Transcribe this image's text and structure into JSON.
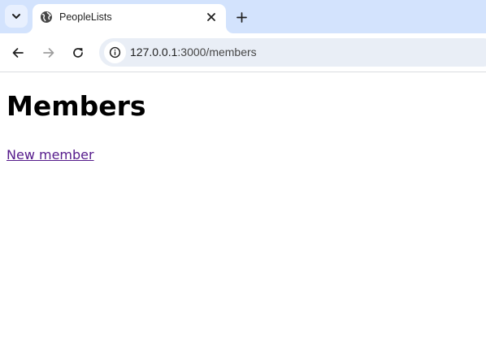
{
  "browser": {
    "tab": {
      "title": "PeopleLists"
    },
    "address_bar": {
      "url_host": "127.0.0.1",
      "url_rest": ":3000/members"
    },
    "colors": {
      "tabstrip_bg": "#d3e3fd",
      "omnibox_bg": "#e9eef6",
      "visited_link": "#551a8b"
    },
    "icons": {
      "tab_search": "chevron-down-icon",
      "favicon": "globe-icon",
      "tab_close": "close-icon",
      "new_tab": "plus-icon",
      "back": "arrow-left-icon",
      "forward": "arrow-right-icon",
      "reload": "reload-icon",
      "site_info": "info-icon"
    }
  },
  "page": {
    "heading": "Members",
    "new_member_link": "New member"
  }
}
